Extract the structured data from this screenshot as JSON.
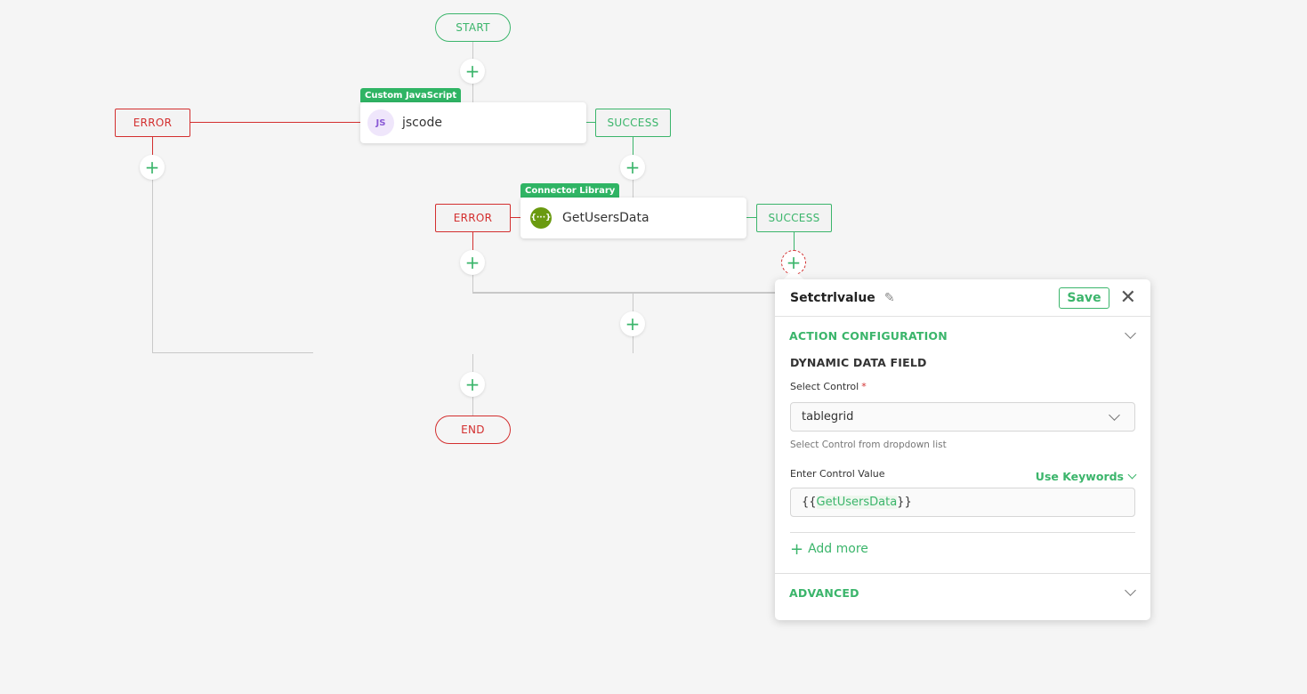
{
  "flow": {
    "start_label": "START",
    "end_label": "END",
    "add_symbol": "+",
    "nodes": [
      {
        "tag": "Custom JavaScript",
        "icon": "js-icon",
        "icon_text": "JS",
        "title": "jscode",
        "error_label": "ERROR",
        "success_label": "SUCCESS"
      },
      {
        "tag": "Connector Library",
        "icon": "api-braces-icon",
        "icon_text": "{···}",
        "title": "GetUsersData",
        "error_label": "ERROR",
        "success_label": "SUCCESS"
      }
    ]
  },
  "panel": {
    "title": "Setctrlvalue",
    "edit_icon": "pencil-icon",
    "save_label": "Save",
    "close_icon": "close-icon",
    "close_symbol": "✕",
    "sections": {
      "action_configuration": {
        "label": "ACTION CONFIGURATION",
        "subheading": "DYNAMIC DATA FIELD",
        "select_control": {
          "label": "Select Control",
          "required_marker": "*",
          "value": "tablegrid",
          "helper": "Select Control from dropdown list"
        },
        "control_value": {
          "label": "Enter Control Value",
          "keywords_label": "Use Keywords",
          "value_prefix": "{{",
          "value_keyword": "GetUsersData",
          "value_suffix": "}}"
        },
        "add_more_label": "Add more"
      },
      "advanced": {
        "label": "ADVANCED"
      }
    }
  },
  "colors": {
    "accent_green": "#3bb56b",
    "error_red": "#d32f2f",
    "tag_green": "#2fb464",
    "background": "#f5f5f5"
  }
}
